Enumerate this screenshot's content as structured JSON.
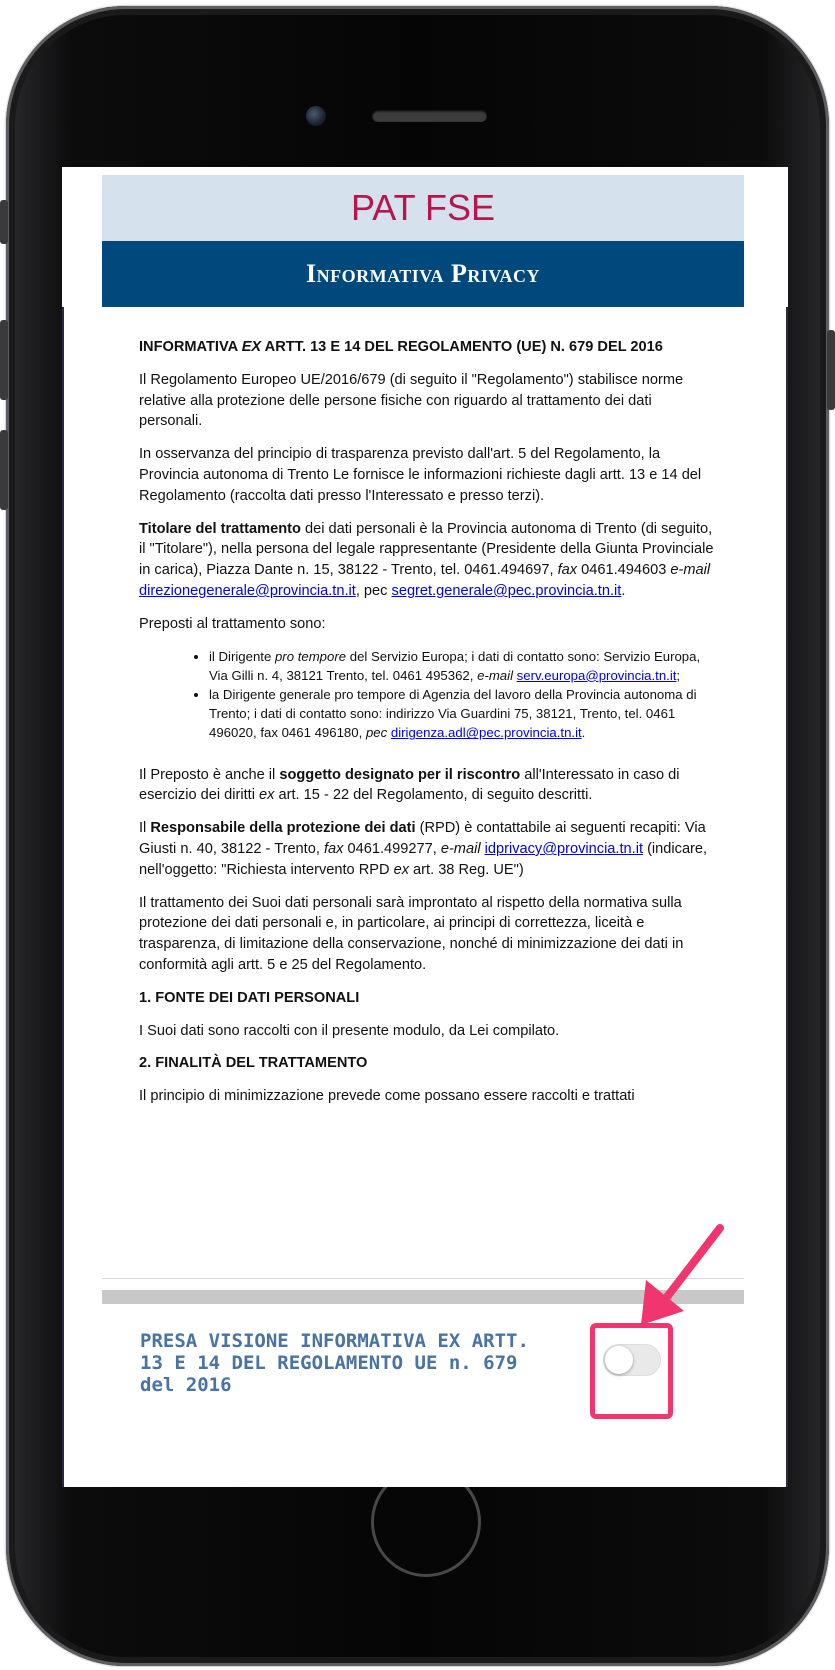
{
  "colors": {
    "title": "#b5174c",
    "header_bg": "#01497c",
    "title_bg": "#d5e1ec",
    "footer_label": "#4873a3",
    "highlight": "#f0356f"
  },
  "app": {
    "title": "PAT FSE",
    "header": "Informativa Privacy"
  },
  "doc": {
    "heading_a": "INFORMATIVA ",
    "heading_ex": "EX",
    "heading_b": " ARTT. 13 E 14 DEL REGOLAMENTO (UE) N. 679 DEL 2016",
    "p1": "Il Regolamento Europeo UE/2016/679 (di seguito il \"Regolamento\") stabilisce norme relative alla protezione delle persone fisiche con riguardo al trattamento dei dati personali.",
    "p2": "In osservanza del principio di trasparenza previsto dall'art. 5 del Regolamento, la Provincia autonoma di Trento Le fornisce le informazioni richieste dagli artt. 13 e 14 del Regolamento (raccolta dati presso l'Interessato e presso terzi).",
    "p3_bold": "Titolare del trattamento",
    "p3_a": " dei dati personali è la Provincia autonoma di Trento (di seguito, il \"Titolare\"), nella persona del legale rappresentante (Presidente della Giunta Provinciale in carica), Piazza Dante n. 15, 38122 - Trento, tel. 0461.494697, ",
    "p3_fax": "fax",
    "p3_b": " 0461.494603 ",
    "p3_email": "e-mail",
    "p3_link1": "direzionegenerale@provincia.tn.it",
    "p3_c": ", pec ",
    "p3_link2": "segret.generale@pec.provincia.tn.it",
    "p3_d": ".",
    "p4": "Preposti al trattamento sono:",
    "li1_a": "il Dirigente ",
    "li1_italic": "pro tempore",
    "li1_b": " del Servizio Europa; i dati di contatto sono: Servizio Europa, Via Gilli n. 4, 38121 Trento, tel. 0461 495362, ",
    "li1_email": "e-mail",
    "li1_link": "serv.europa@provincia.tn.it",
    "li1_c": ";",
    "li2_a": "la Dirigente generale pro tempore di Agenzia del lavoro della Provincia autonoma di Trento; i dati di contatto sono: indirizzo Via Guardini 75, 38121, Trento, tel. 0461 496020, fax 0461 496180, ",
    "li2_pec": "pec",
    "li2_link": "dirigenza.adl@pec.provincia.tn.it",
    "li2_b": ".",
    "p5_a": "Il Preposto è anche il ",
    "p5_bold": "soggetto designato per il riscontro",
    "p5_b": " all'Interessato in caso di esercizio dei diritti ",
    "p5_ex": "ex",
    "p5_c": " art. 15 - 22 del Regolamento, di seguito descritti.",
    "p6_a": "Il ",
    "p6_bold": "Responsabile della protezione dei dati",
    "p6_b": " (RPD) è contattabile ai seguenti recapiti: Via Giusti n. 40, 38122 - Trento, ",
    "p6_fax": "fax",
    "p6_c": " 0461.499277, ",
    "p6_email": "e-mail",
    "p6_link": "idprivacy@provincia.tn.it",
    "p6_d": " (indicare, nell'oggetto: \"Richiesta intervento RPD ",
    "p6_ex": "ex",
    "p6_e": " art. 38 Reg. UE\")",
    "p7": "Il trattamento dei Suoi dati personali sarà improntato al rispetto della normativa sulla protezione dei dati personali e, in particolare, ai principi di correttezza, liceità e trasparenza, di limitazione della conservazione, nonché di minimizzazione dei dati in conformità agli artt. 5 e 25 del Regolamento.",
    "s1_title": "1. FONTE DEI DATI PERSONALI",
    "s1_text": "I Suoi dati sono raccolti con il presente modulo, da Lei compilato.",
    "s2_title": "2. FINALITÀ DEL TRATTAMENTO",
    "s2_text": "Il principio di minimizzazione prevede come possano essere raccolti e trattati"
  },
  "footer": {
    "consent_label": "PRESA VISIONE INFORMATIVA EX ARTT. 13 E 14 DEL REGOLAMENTO UE n. 679 del 2016",
    "toggle_on": false
  }
}
